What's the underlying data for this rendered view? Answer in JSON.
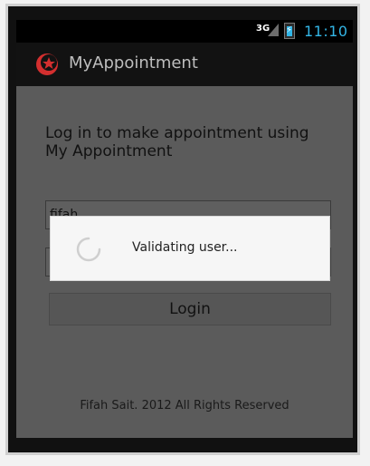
{
  "status_bar": {
    "network_label": "3G",
    "time": "11:10",
    "accent_color": "#33b5e5"
  },
  "action_bar": {
    "app_title": "MyAppointment",
    "icon": "app-logo-icon"
  },
  "login_screen": {
    "header_text": "Log in to make appointment using My Appointment",
    "username_value": "fifah",
    "password_value": "",
    "login_button_label": "Login",
    "footer_text": "Fifah Sait. 2012 All Rights Reserved"
  },
  "progress_dialog": {
    "message": "Validating user...",
    "icon": "loading-spinner-icon"
  }
}
